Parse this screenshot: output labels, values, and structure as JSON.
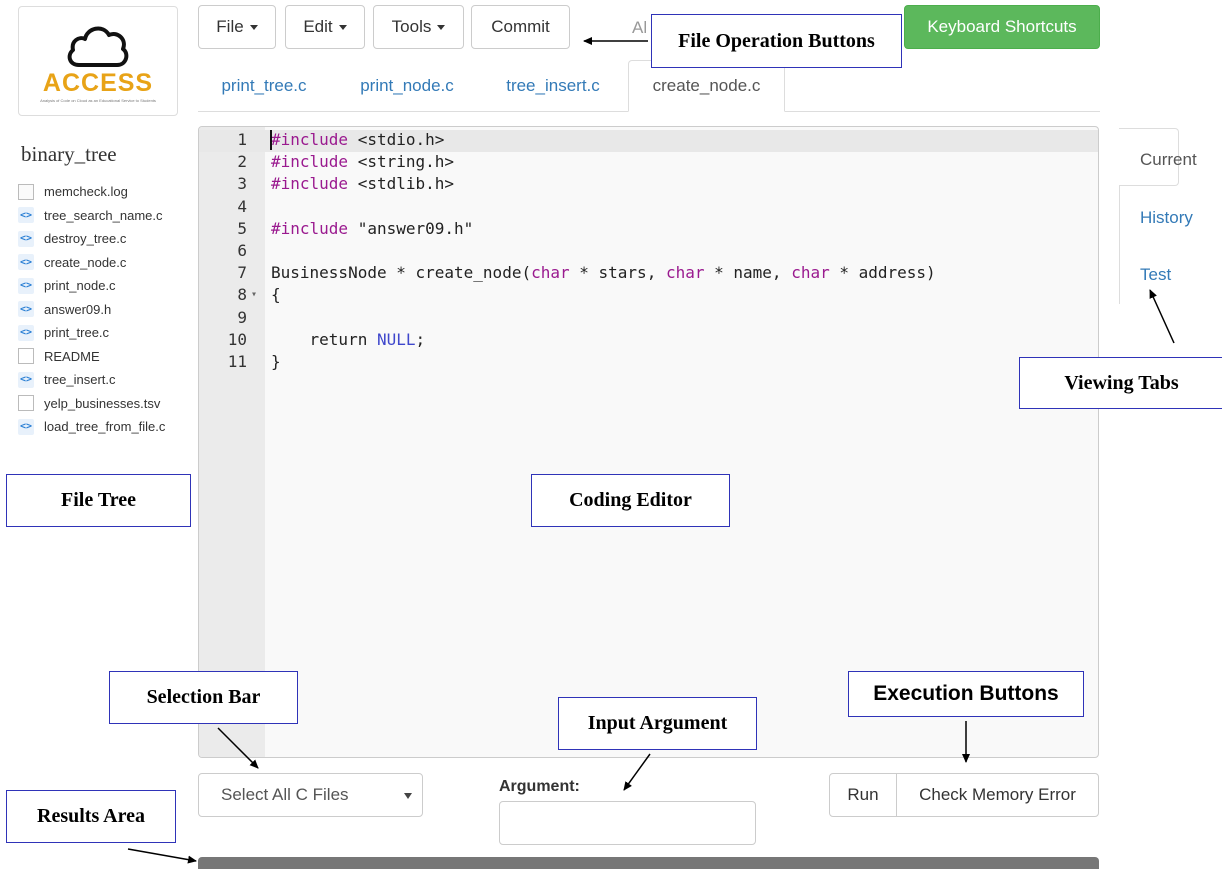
{
  "logo": {
    "text": "ACCESS",
    "subtitle": "Analysis of Code on Cloud as an Educational Service to Students"
  },
  "toolbar": {
    "file_label": "File",
    "edit_label": "Edit",
    "tools_label": "Tools",
    "commit_label": "Commit",
    "hidden_label": "Al",
    "shortcuts_label": "Keyboard Shortcuts"
  },
  "file_tabs": [
    {
      "label": "print_tree.c",
      "active": false
    },
    {
      "label": "print_node.c",
      "active": false
    },
    {
      "label": "tree_insert.c",
      "active": false
    },
    {
      "label": "create_node.c",
      "active": true
    }
  ],
  "file_tree": {
    "project_name": "binary_tree",
    "files": [
      {
        "name": "memcheck.log",
        "icon": "document-icon"
      },
      {
        "name": "tree_search_name.c",
        "icon": "code-file-icon"
      },
      {
        "name": "destroy_tree.c",
        "icon": "code-file-icon"
      },
      {
        "name": "create_node.c",
        "icon": "code-file-icon"
      },
      {
        "name": "print_node.c",
        "icon": "code-file-icon"
      },
      {
        "name": "answer09.h",
        "icon": "code-file-icon"
      },
      {
        "name": "print_tree.c",
        "icon": "code-file-icon"
      },
      {
        "name": "README",
        "icon": "blank-file-icon"
      },
      {
        "name": "tree_insert.c",
        "icon": "code-file-icon"
      },
      {
        "name": "yelp_businesses.tsv",
        "icon": "blank-file-icon"
      },
      {
        "name": "load_tree_from_file.c",
        "icon": "code-file-icon"
      }
    ]
  },
  "editor": {
    "lines": [
      {
        "n": "1",
        "parts": [
          [
            "kw-inc",
            "#include"
          ],
          [
            "str",
            " <stdio.h>"
          ]
        ]
      },
      {
        "n": "2",
        "parts": [
          [
            "kw-inc",
            "#include"
          ],
          [
            "str",
            " <string.h>"
          ]
        ]
      },
      {
        "n": "3",
        "parts": [
          [
            "kw-inc",
            "#include"
          ],
          [
            "str",
            " <stdlib.h>"
          ]
        ]
      },
      {
        "n": "4",
        "parts": []
      },
      {
        "n": "5",
        "parts": [
          [
            "kw-inc",
            "#include"
          ],
          [
            "str",
            " \"answer09.h\""
          ]
        ]
      },
      {
        "n": "6",
        "parts": []
      },
      {
        "n": "7",
        "parts": [
          [
            "str",
            "BusinessNode * create_node("
          ],
          [
            "kw",
            "char"
          ],
          [
            "str",
            " * stars, "
          ],
          [
            "kw",
            "char"
          ],
          [
            "str",
            " * name, "
          ],
          [
            "kw",
            "char"
          ],
          [
            "str",
            " * address)"
          ]
        ]
      },
      {
        "n": "8",
        "fold": "▾",
        "parts": [
          [
            "str",
            "{"
          ]
        ]
      },
      {
        "n": "9",
        "parts": []
      },
      {
        "n": "10",
        "parts": [
          [
            "str",
            "    return "
          ],
          [
            "kw2",
            "NULL"
          ],
          [
            "str",
            ";"
          ]
        ]
      },
      {
        "n": "11",
        "parts": [
          [
            "str",
            "}"
          ]
        ]
      }
    ]
  },
  "view_tabs": {
    "current_label": "Current",
    "history_label": "History",
    "test_label": "Test"
  },
  "bottom": {
    "select_value": "Select All C Files",
    "argument_label": "Argument:",
    "argument_value": "",
    "run_label": "Run",
    "memcheck_label": "Check Memory Error"
  },
  "annotations": {
    "file_ops": "File Operation Buttons",
    "viewing_tabs": "Viewing Tabs",
    "file_tree": "File Tree",
    "coding_editor": "Coding Editor",
    "selection_bar": "Selection Bar",
    "input_argument": "Input Argument",
    "execution_buttons": "Execution Buttons",
    "results_area": "Results Area"
  },
  "colors": {
    "link": "#337ab7",
    "success": "#5cb85c",
    "logo": "#e8a317",
    "annotation_border": "#2f33b8",
    "keyword": "#9a1a8f",
    "constant": "#3f47cc"
  }
}
